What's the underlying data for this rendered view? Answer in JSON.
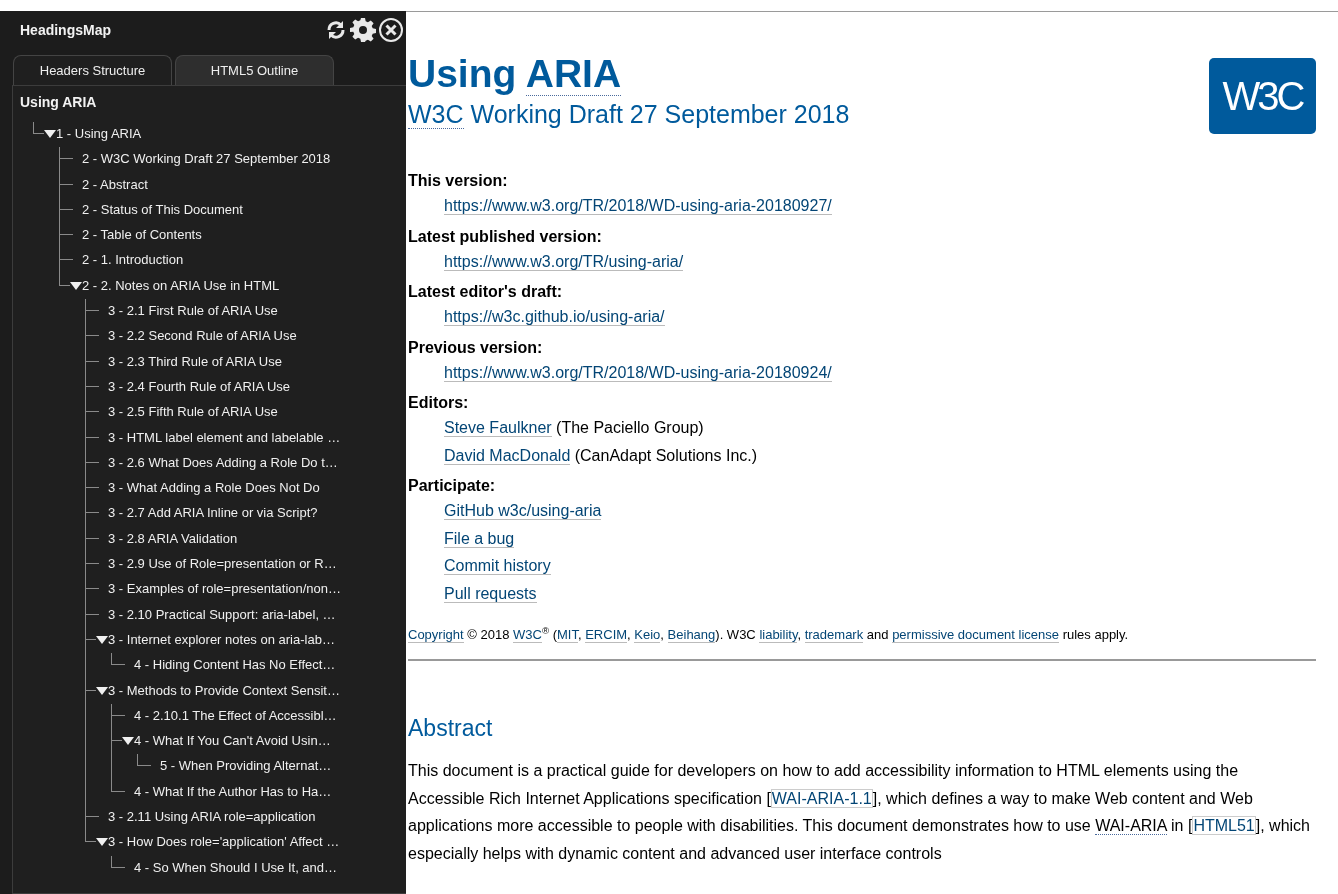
{
  "sidebar": {
    "title": "HeadingsMap",
    "tabs": [
      {
        "label": "Headers Structure",
        "selected": true
      },
      {
        "label": "HTML5 Outline",
        "selected": false
      }
    ],
    "outline_title": "Using ARIA",
    "tree": [
      {
        "text": "1 - Using ARIA",
        "expanded": true,
        "children": [
          {
            "text": "2 - W3C Working Draft 27 September 2018"
          },
          {
            "text": "2 - Abstract"
          },
          {
            "text": "2 - Status of This Document"
          },
          {
            "text": "2 - Table of Contents"
          },
          {
            "text": "2 - 1. Introduction"
          },
          {
            "text": "2 - 2. Notes on ARIA Use in HTML",
            "expanded": true,
            "children": [
              {
                "text": "3 - 2.1 First Rule of ARIA Use"
              },
              {
                "text": "3 - 2.2 Second Rule of ARIA Use"
              },
              {
                "text": "3 - 2.3 Third Rule of ARIA Use"
              },
              {
                "text": "3 - 2.4 Fourth Rule of ARIA Use"
              },
              {
                "text": "3 - 2.5 Fifth Rule of ARIA Use"
              },
              {
                "text": "3 - HTML label element and labelable …"
              },
              {
                "text": "3 - 2.6 What Does Adding a Role Do t…"
              },
              {
                "text": "3 - What Adding a Role Does Not Do"
              },
              {
                "text": "3 - 2.7 Add ARIA Inline or via Script?"
              },
              {
                "text": "3 - 2.8 ARIA Validation"
              },
              {
                "text": "3 - 2.9 Use of Role=presentation or R…"
              },
              {
                "text": "3 - Examples of role=presentation/non…"
              },
              {
                "text": "3 - 2.10 Practical Support: aria-label, …"
              },
              {
                "text": "3 - Internet explorer notes on aria-lab…",
                "expanded": true,
                "children": [
                  {
                    "text": "4 - Hiding Content Has No Effect…"
                  }
                ]
              },
              {
                "text": "3 - Methods to Provide Context Sensit…",
                "expanded": true,
                "children": [
                  {
                    "text": "4 - 2.10.1 The Effect of Accessibl…"
                  },
                  {
                    "text": "4 - What If You Can't Avoid Usin…",
                    "expanded": true,
                    "children": [
                      {
                        "text": "5 - When Providing Alternat…"
                      }
                    ]
                  },
                  {
                    "text": "4 - What If the Author Has to Ha…"
                  }
                ]
              },
              {
                "text": "3 - 2.11 Using ARIA role=application"
              },
              {
                "text": "3 - How Does role='application' Affect …",
                "expanded": true,
                "children": [
                  {
                    "text": "4 - So When Should I Use It, and…"
                  }
                ]
              }
            ]
          }
        ]
      }
    ]
  },
  "page": {
    "title": [
      {
        "text": "Using ",
        "kind": "text"
      },
      {
        "text": "ARIA",
        "kind": "abbr"
      }
    ],
    "subtitle": [
      {
        "text": "W3C",
        "kind": "abbr"
      },
      {
        "text": " Working Draft 27 September 2018",
        "kind": "text"
      }
    ],
    "logo": "W3C",
    "meta": [
      {
        "term": "This version:",
        "entries": [
          [
            {
              "text": "https://www.w3.org/TR/2018/WD-using-aria-20180927/",
              "kind": "link"
            }
          ]
        ]
      },
      {
        "term": "Latest published version:",
        "entries": [
          [
            {
              "text": "https://www.w3.org/TR/using-aria/",
              "kind": "link"
            }
          ]
        ]
      },
      {
        "term": "Latest editor's draft:",
        "entries": [
          [
            {
              "text": "https://w3c.github.io/using-aria/",
              "kind": "link"
            }
          ]
        ]
      },
      {
        "term": "Previous version:",
        "entries": [
          [
            {
              "text": "https://www.w3.org/TR/2018/WD-using-aria-20180924/",
              "kind": "link"
            }
          ]
        ]
      },
      {
        "term": "Editors:",
        "entries": [
          [
            {
              "text": "Steve Faulkner",
              "kind": "link"
            },
            {
              "text": " (The Paciello Group)",
              "kind": "text"
            }
          ],
          [
            {
              "text": "David MacDonald",
              "kind": "link"
            },
            {
              "text": " (CanAdapt Solutions Inc.)",
              "kind": "text"
            }
          ]
        ]
      },
      {
        "term": "Participate:",
        "entries": [
          [
            {
              "text": "GitHub w3c/using-aria",
              "kind": "link"
            }
          ],
          [
            {
              "text": "File a bug",
              "kind": "link"
            }
          ],
          [
            {
              "text": "Commit history",
              "kind": "link"
            }
          ],
          [
            {
              "text": "Pull requests",
              "kind": "link"
            }
          ]
        ]
      }
    ],
    "copyright": [
      {
        "text": "Copyright",
        "kind": "link"
      },
      {
        "text": " © 2018 ",
        "kind": "text"
      },
      {
        "text": "W3C",
        "kind": "link"
      },
      {
        "text": "$^{®}$ (",
        "kind": "text"
      },
      {
        "text": "MIT",
        "kind": "link"
      },
      {
        "text": ", ",
        "kind": "text"
      },
      {
        "text": "ERCIM",
        "kind": "link"
      },
      {
        "text": ", ",
        "kind": "text"
      },
      {
        "text": "Keio",
        "kind": "link"
      },
      {
        "text": ", ",
        "kind": "text"
      },
      {
        "text": "Beihang",
        "kind": "link"
      },
      {
        "text": "). W3C ",
        "kind": "text"
      },
      {
        "text": "liability",
        "kind": "link"
      },
      {
        "text": ", ",
        "kind": "text"
      },
      {
        "text": "trademark",
        "kind": "link"
      },
      {
        "text": " and ",
        "kind": "text"
      },
      {
        "text": "permissive document license",
        "kind": "link"
      },
      {
        "text": " rules apply.",
        "kind": "text"
      }
    ],
    "abstract": {
      "heading": "Abstract",
      "paragraph": [
        {
          "text": "This document is a practical guide for developers on how to add accessibility information to HTML elements using the Accessible Rich Internet Applications specification [",
          "kind": "text"
        },
        {
          "text": "WAI-ARIA-1.1",
          "kind": "ref"
        },
        {
          "text": "], which defines a way to make Web content and Web applications more accessible to people with disabilities. This document demonstrates how to use ",
          "kind": "text"
        },
        {
          "text": "WAI-ARIA",
          "kind": "abbr"
        },
        {
          "text": " in [",
          "kind": "text"
        },
        {
          "text": "HTML51",
          "kind": "ref"
        },
        {
          "text": "], which especially helps with dynamic content and advanced user interface controls",
          "kind": "text"
        }
      ]
    }
  }
}
